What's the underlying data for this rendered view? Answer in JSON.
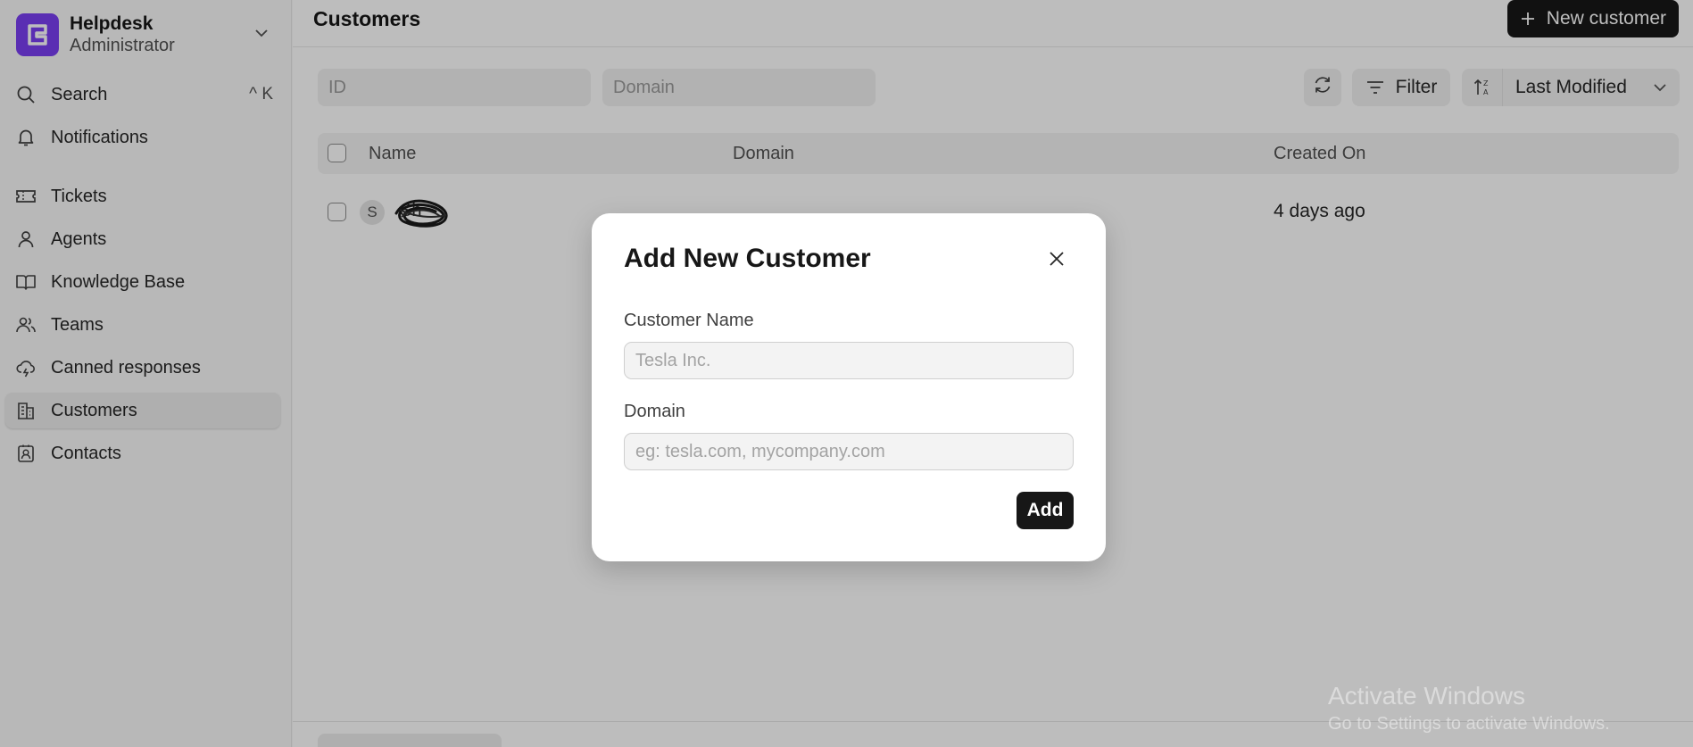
{
  "sidebar": {
    "brand_title": "Helpdesk",
    "brand_subtitle": "Administrator",
    "search_label": "Search",
    "search_shortcut": "^ K",
    "notifications_label": "Notifications",
    "items": [
      {
        "label": "Tickets",
        "icon": "ticket-icon"
      },
      {
        "label": "Agents",
        "icon": "user-icon"
      },
      {
        "label": "Knowledge Base",
        "icon": "book-icon"
      },
      {
        "label": "Teams",
        "icon": "users-icon"
      },
      {
        "label": "Canned responses",
        "icon": "cloud-lightning-icon"
      },
      {
        "label": "Customers",
        "icon": "building-icon",
        "active": true
      },
      {
        "label": "Contacts",
        "icon": "contact-icon"
      }
    ],
    "accent": "#7a3ff2"
  },
  "header": {
    "title": "Customers",
    "new_button": "New customer"
  },
  "filters": {
    "id_placeholder": "ID",
    "domain_placeholder": "Domain",
    "filter_label": "Filter",
    "sort_label": "Last Modified"
  },
  "table": {
    "columns": [
      "Name",
      "Domain",
      "Created On"
    ],
    "rows": [
      {
        "avatar": "S",
        "name": "Sh",
        "domain": "",
        "created": "4 days ago"
      }
    ]
  },
  "modal": {
    "title": "Add New Customer",
    "name_label": "Customer Name",
    "name_placeholder": "Tesla Inc.",
    "domain_label": "Domain",
    "domain_placeholder": "eg: tesla.com, mycompany.com",
    "add_label": "Add"
  },
  "watermark": {
    "line1": "Activate Windows",
    "line2": "Go to Settings to activate Windows."
  }
}
